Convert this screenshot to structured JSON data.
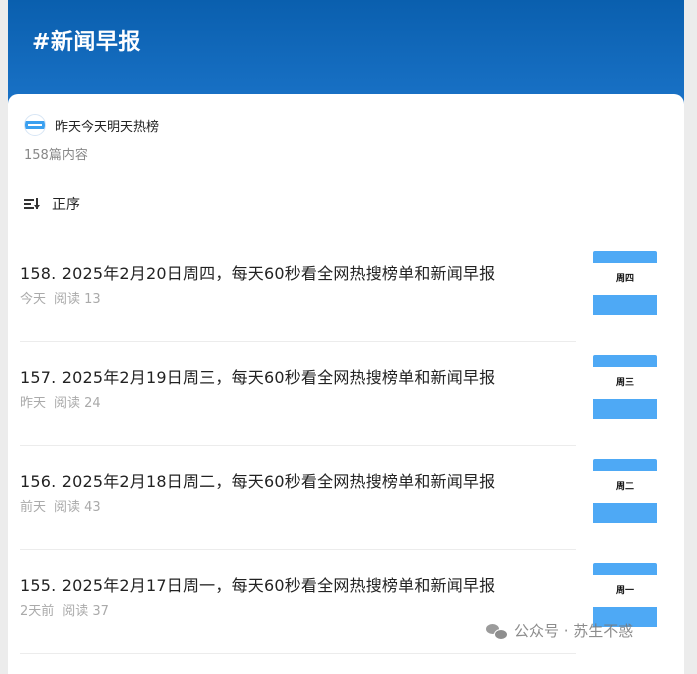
{
  "header": {
    "title": "#新闻早报"
  },
  "account": {
    "name": "昨天今天明天热榜",
    "count": "158篇内容"
  },
  "sort": {
    "label": "正序"
  },
  "articles": [
    {
      "title": "158. 2025年2月20日周四，每天60秒看全网热搜榜单和新闻早报",
      "time": "今天",
      "reads": "阅读 13",
      "thumb_day": "周四"
    },
    {
      "title": "157. 2025年2月19日周三，每天60秒看全网热搜榜单和新闻早报",
      "time": "昨天",
      "reads": "阅读 24",
      "thumb_day": "周三"
    },
    {
      "title": "156. 2025年2月18日周二，每天60秒看全网热搜榜单和新闻早报",
      "time": "前天",
      "reads": "阅读 43",
      "thumb_day": "周二"
    },
    {
      "title": "155. 2025年2月17日周一，每天60秒看全网热搜榜单和新闻早报",
      "time": "2天前",
      "reads": "阅读 37",
      "thumb_day": "周一"
    }
  ],
  "watermark": {
    "text": "公众号 · 苏生不惑"
  },
  "colors": {
    "header": "#0a5fae",
    "thumb_accent": "#4ea9f5"
  }
}
